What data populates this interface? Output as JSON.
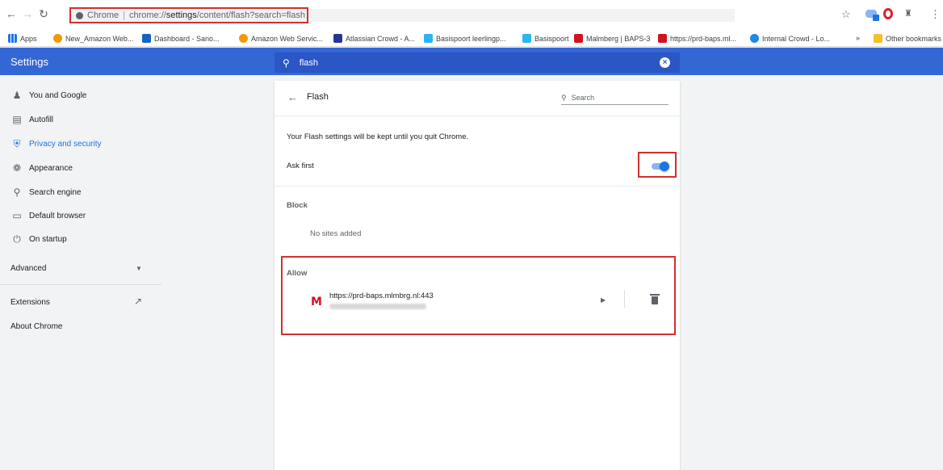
{
  "browser": {
    "url_site": "Chrome",
    "url_path_prefix": "chrome://",
    "url_path_bold": "settings",
    "url_path_rest": "/content/flash?search=flash"
  },
  "bookmarks": [
    {
      "label": "Apps",
      "color": "#1a73e8"
    },
    {
      "label": "New_Amazon Web...",
      "color": "#f29900"
    },
    {
      "label": "Dashboard - Sano...",
      "color": "#1565c0"
    },
    {
      "label": "Amazon Web Servic...",
      "color": "#f29900"
    },
    {
      "label": "Atlassian Crowd - A...",
      "color": "#283593"
    },
    {
      "label": "Basispoort leerlingp...",
      "color": "#29b6f6"
    },
    {
      "label": "Basispoort",
      "color": "#29b6f6"
    },
    {
      "label": "Malmberg | BAPS-3",
      "color": "#d4121e"
    },
    {
      "label": "https://prd-baps.ml...",
      "color": "#d4121e"
    },
    {
      "label": "Internal Crowd - Lo...",
      "color": "#1e88e5"
    }
  ],
  "bookmarks_overflow": "»",
  "other_bookmarks": "Other bookmarks",
  "settings": {
    "title": "Settings",
    "search_value": "flash"
  },
  "sidebar": {
    "items": [
      {
        "label": "You and Google",
        "icon": "person-icon"
      },
      {
        "label": "Autofill",
        "icon": "clipboard-icon"
      },
      {
        "label": "Privacy and security",
        "icon": "shield-icon"
      },
      {
        "label": "Appearance",
        "icon": "palette-icon"
      },
      {
        "label": "Search engine",
        "icon": "search-icon"
      },
      {
        "label": "Default browser",
        "icon": "browser-icon"
      },
      {
        "label": "On startup",
        "icon": "power-icon"
      }
    ],
    "advanced": "Advanced",
    "extensions": "Extensions",
    "about": "About Chrome"
  },
  "flash": {
    "title": "Flash",
    "search_placeholder": "Search",
    "notice": "Your Flash settings will be kept until you quit Chrome.",
    "ask_first_label": "Ask first",
    "ask_first_enabled": true,
    "block_label": "Block",
    "block_empty": "No sites added",
    "allow_label": "Allow",
    "allowed_site": "https://prd-baps.mlmbrg.nl:443"
  },
  "colors": {
    "header_blue": "#3367d6",
    "accent": "#1a73e8",
    "highlight_red": "#d32f2f"
  }
}
